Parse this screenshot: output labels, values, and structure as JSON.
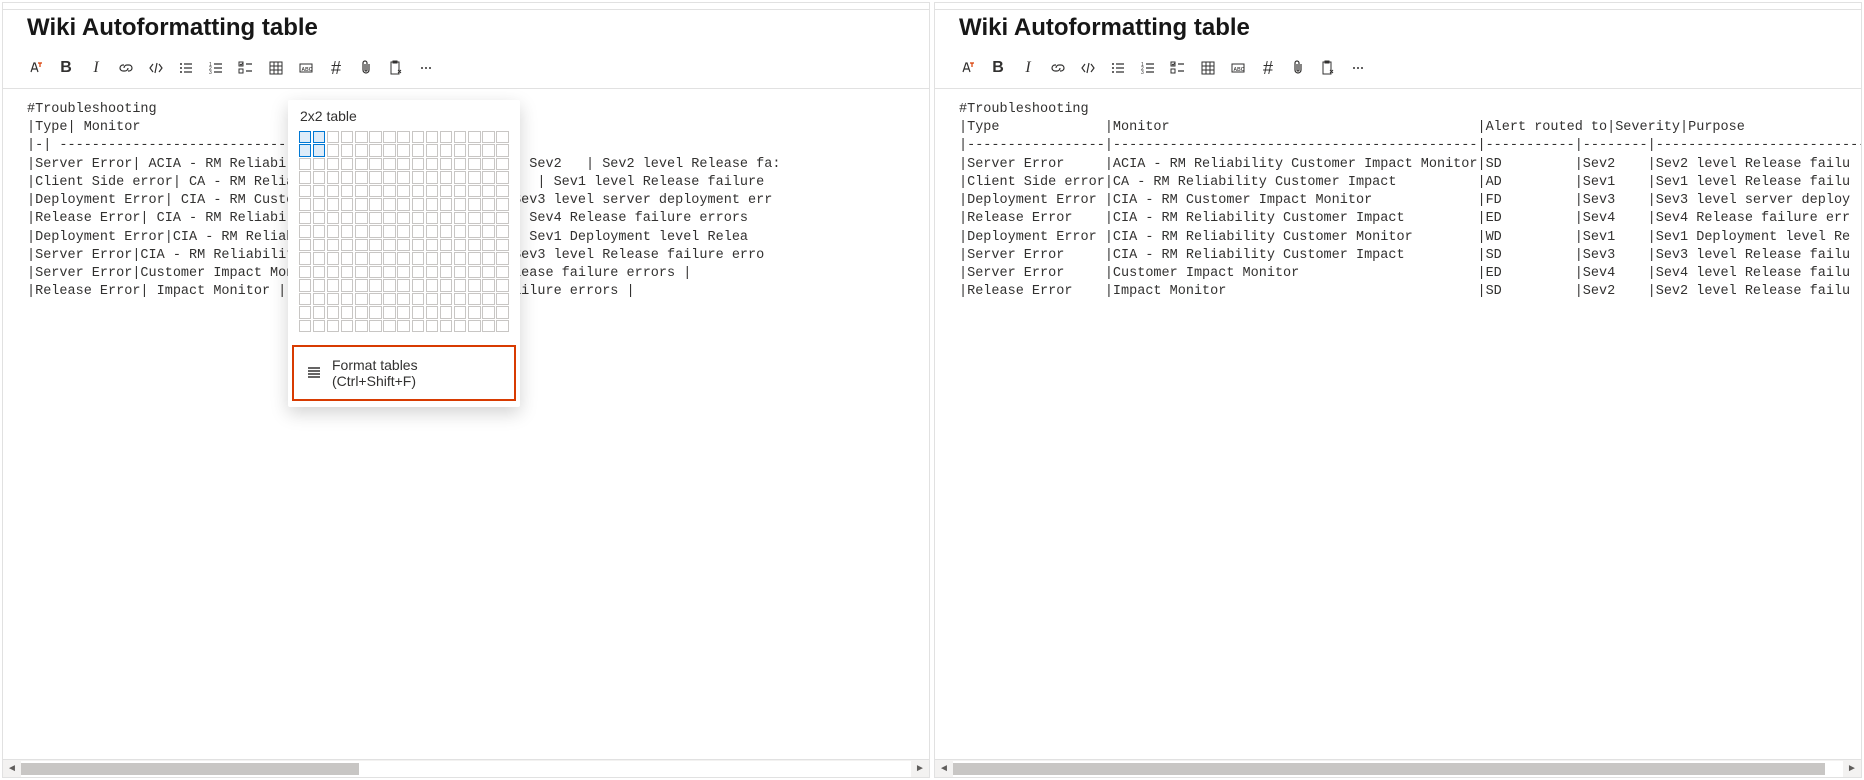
{
  "left": {
    "title": "Wiki Autoformatting table",
    "popup": {
      "label": "2x2 table",
      "format_label": "Format tables (Ctrl+Shift+F)",
      "sel_rows": 2,
      "sel_cols": 2
    },
    "content": "#Troubleshooting\n|Type| Monitor\n|-| -----------------------------\n|Server Error| ACIA - RM Reliability Cu                     | Sev2   | Sev2 level Release fa:\n|Client Side error| CA - RM Reliability               | Sev1   | Sev1 level Release failure\n|Deployment Error| CIA - RM Customer Im              v3   | Sev3 level server deployment err\n|Release Error| CIA - RM Reliability Cu              Sev4   | Sev4 Release failure errors\n|Deployment Error|CIA - RM Reliability               Sev1   | Sev1 Deployment level Relea\n|Server Error|CIA - RM Reliability Cust              v3   | Sev3 level Release failure erro\n|Server Error|Customer Impact Monitor               level Release failure errors |\n|Release Error| Impact Monitor | SD                 elease failure errors |"
  },
  "right": {
    "title": "Wiki Autoformatting table",
    "content": "#Troubleshooting\n|Type             |Monitor                                      |Alert routed to|Severity|Purpose\n|-----------------|---------------------------------------------|-----------|--------|----------------------------\n|Server Error     |ACIA - RM Reliability Customer Impact Monitor|SD         |Sev2    |Sev2 level Release failu\n|Client Side error|CA - RM Reliability Customer Impact          |AD         |Sev1    |Sev1 level Release failu\n|Deployment Error |CIA - RM Customer Impact Monitor             |FD         |Sev3    |Sev3 level server deploy\n|Release Error    |CIA - RM Reliability Customer Impact         |ED         |Sev4    |Sev4 Release failure err\n|Deployment Error |CIA - RM Reliability Customer Monitor        |WD         |Sev1    |Sev1 Deployment level Re\n|Server Error     |CIA - RM Reliability Customer Impact         |SD         |Sev3    |Sev3 level Release failu\n|Server Error     |Customer Impact Monitor                      |ED         |Sev4    |Sev4 level Release failu\n|Release Error    |Impact Monitor                               |SD         |Sev2    |Sev2 level Release failu"
  },
  "toolbar": {
    "style_icon": "text-style",
    "bold": "B",
    "italic": "I",
    "hash": "#"
  }
}
